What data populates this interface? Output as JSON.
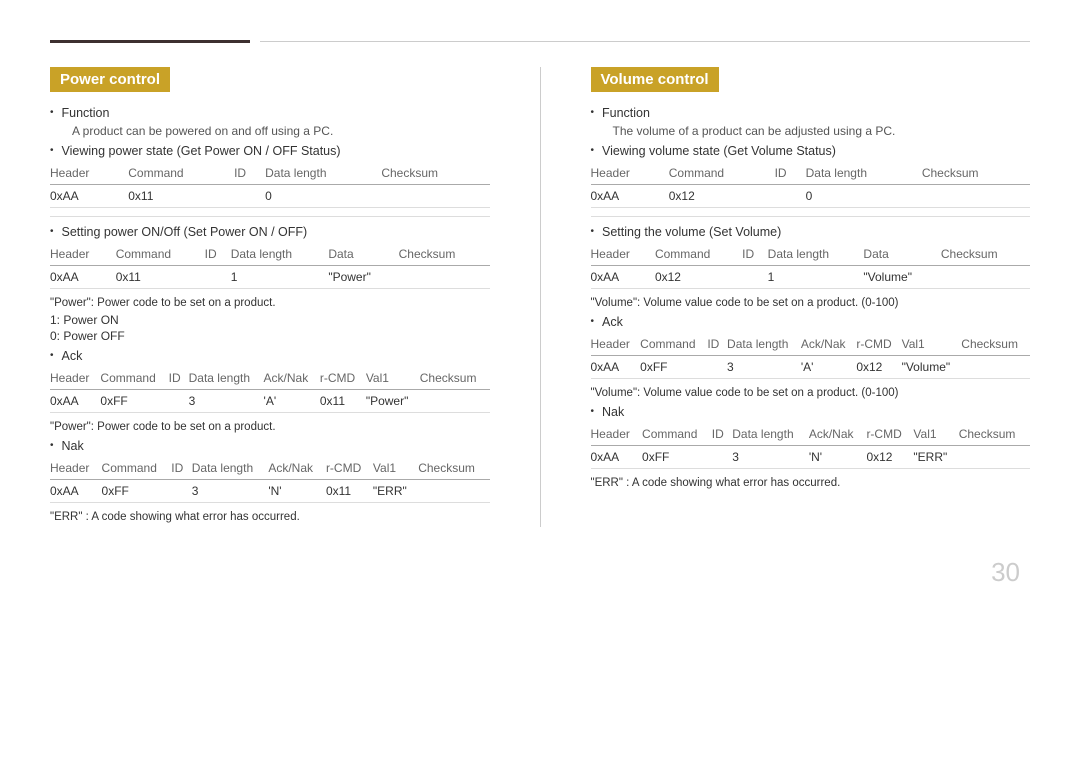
{
  "page": {
    "page_number": "30",
    "top_bar": {
      "left_label": "thick-line",
      "right_label": "thin-line"
    }
  },
  "power_control": {
    "title": "Power control",
    "function_label": "Function",
    "function_desc": "A product can be powered on and off using a PC.",
    "viewing_state_label": "Viewing power state (Get Power ON / OFF Status)",
    "table1_headers": [
      "Header",
      "Command",
      "ID",
      "Data length",
      "Checksum"
    ],
    "table1_row": [
      "0xAA",
      "0x11",
      "",
      "0",
      ""
    ],
    "setting_label": "Setting power ON/Off (Set Power ON / OFF)",
    "table2_headers": [
      "Header",
      "Command",
      "ID",
      "Data length",
      "Data",
      "Checksum"
    ],
    "table2_row": [
      "0xAA",
      "0x11",
      "",
      "1",
      "\"Power\"",
      ""
    ],
    "note1": "\"Power\": Power code to be set on a product.",
    "list1": "1: Power ON",
    "list2": "0: Power OFF",
    "ack_label": "Ack",
    "table3_headers": [
      "Header",
      "Command",
      "ID",
      "Data length",
      "Ack/Nak",
      "r-CMD",
      "Val1",
      "Checksum"
    ],
    "table3_row": [
      "0xAA",
      "0xFF",
      "",
      "3",
      "'A'",
      "0x11",
      "\"Power\"",
      ""
    ],
    "note2": "\"Power\": Power code to be set on a product.",
    "nak_label": "Nak",
    "table4_headers": [
      "Header",
      "Command",
      "ID",
      "Data length",
      "Ack/Nak",
      "r-CMD",
      "Val1",
      "Checksum"
    ],
    "table4_row": [
      "0xAA",
      "0xFF",
      "",
      "3",
      "'N'",
      "0x11",
      "\"ERR\"",
      ""
    ],
    "err_note": "\"ERR\" : A code showing what error has occurred."
  },
  "volume_control": {
    "title": "Volume control",
    "function_label": "Function",
    "function_desc": "The volume of a product can be adjusted using a PC.",
    "viewing_state_label": "Viewing volume state (Get Volume Status)",
    "table1_headers": [
      "Header",
      "Command",
      "ID",
      "Data length",
      "Checksum"
    ],
    "table1_row": [
      "0xAA",
      "0x12",
      "",
      "0",
      ""
    ],
    "setting_label": "Setting the volume (Set Volume)",
    "table2_headers": [
      "Header",
      "Command",
      "ID",
      "Data length",
      "Data",
      "Checksum"
    ],
    "table2_row": [
      "0xAA",
      "0x12",
      "",
      "1",
      "\"Volume\"",
      ""
    ],
    "note1": "\"Volume\": Volume value code to be set on a product. (0-100)",
    "ack_label": "Ack",
    "table3_headers": [
      "Header",
      "Command",
      "ID",
      "Data length",
      "Ack/Nak",
      "r-CMD",
      "Val1",
      "Checksum"
    ],
    "table3_row": [
      "0xAA",
      "0xFF",
      "",
      "3",
      "'A'",
      "0x12",
      "\"Volume\"",
      ""
    ],
    "note2": "\"Volume\": Volume value code to be set on a product. (0-100)",
    "nak_label": "Nak",
    "table4_headers": [
      "Header",
      "Command",
      "ID",
      "Data length",
      "Ack/Nak",
      "r-CMD",
      "Val1",
      "Checksum"
    ],
    "table4_row": [
      "0xAA",
      "0xFF",
      "",
      "3",
      "'N'",
      "0x12",
      "\"ERR\"",
      ""
    ],
    "err_note": "\"ERR\" : A code showing what error has occurred."
  }
}
